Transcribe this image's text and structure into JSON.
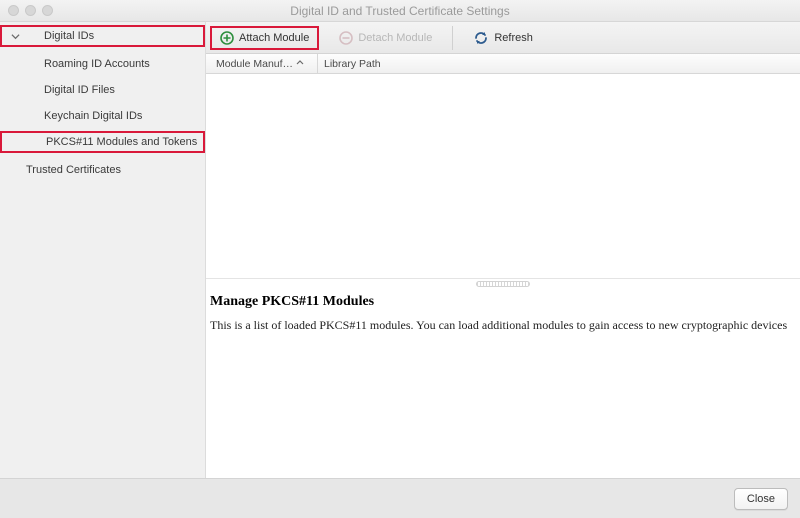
{
  "window": {
    "title": "Digital ID and Trusted Certificate Settings"
  },
  "sidebar": {
    "root": {
      "label": "Digital IDs",
      "expanded": true
    },
    "items": [
      {
        "label": "Roaming ID Accounts"
      },
      {
        "label": "Digital ID Files"
      },
      {
        "label": "Keychain Digital IDs"
      },
      {
        "label": "PKCS#11 Modules and Tokens",
        "highlighted": true
      }
    ],
    "trusted": {
      "label": "Trusted Certificates"
    }
  },
  "toolbar": {
    "attach": "Attach Module",
    "detach": "Detach Module",
    "refresh": "Refresh"
  },
  "columns": {
    "c1": "Module Manuf…",
    "c2": "Library Path"
  },
  "detail": {
    "heading": "Manage PKCS#11 Modules",
    "body": "This is a list of loaded PKCS#11 modules. You can load additional modules to gain access to new cryptographic devices"
  },
  "footer": {
    "close": "Close"
  }
}
